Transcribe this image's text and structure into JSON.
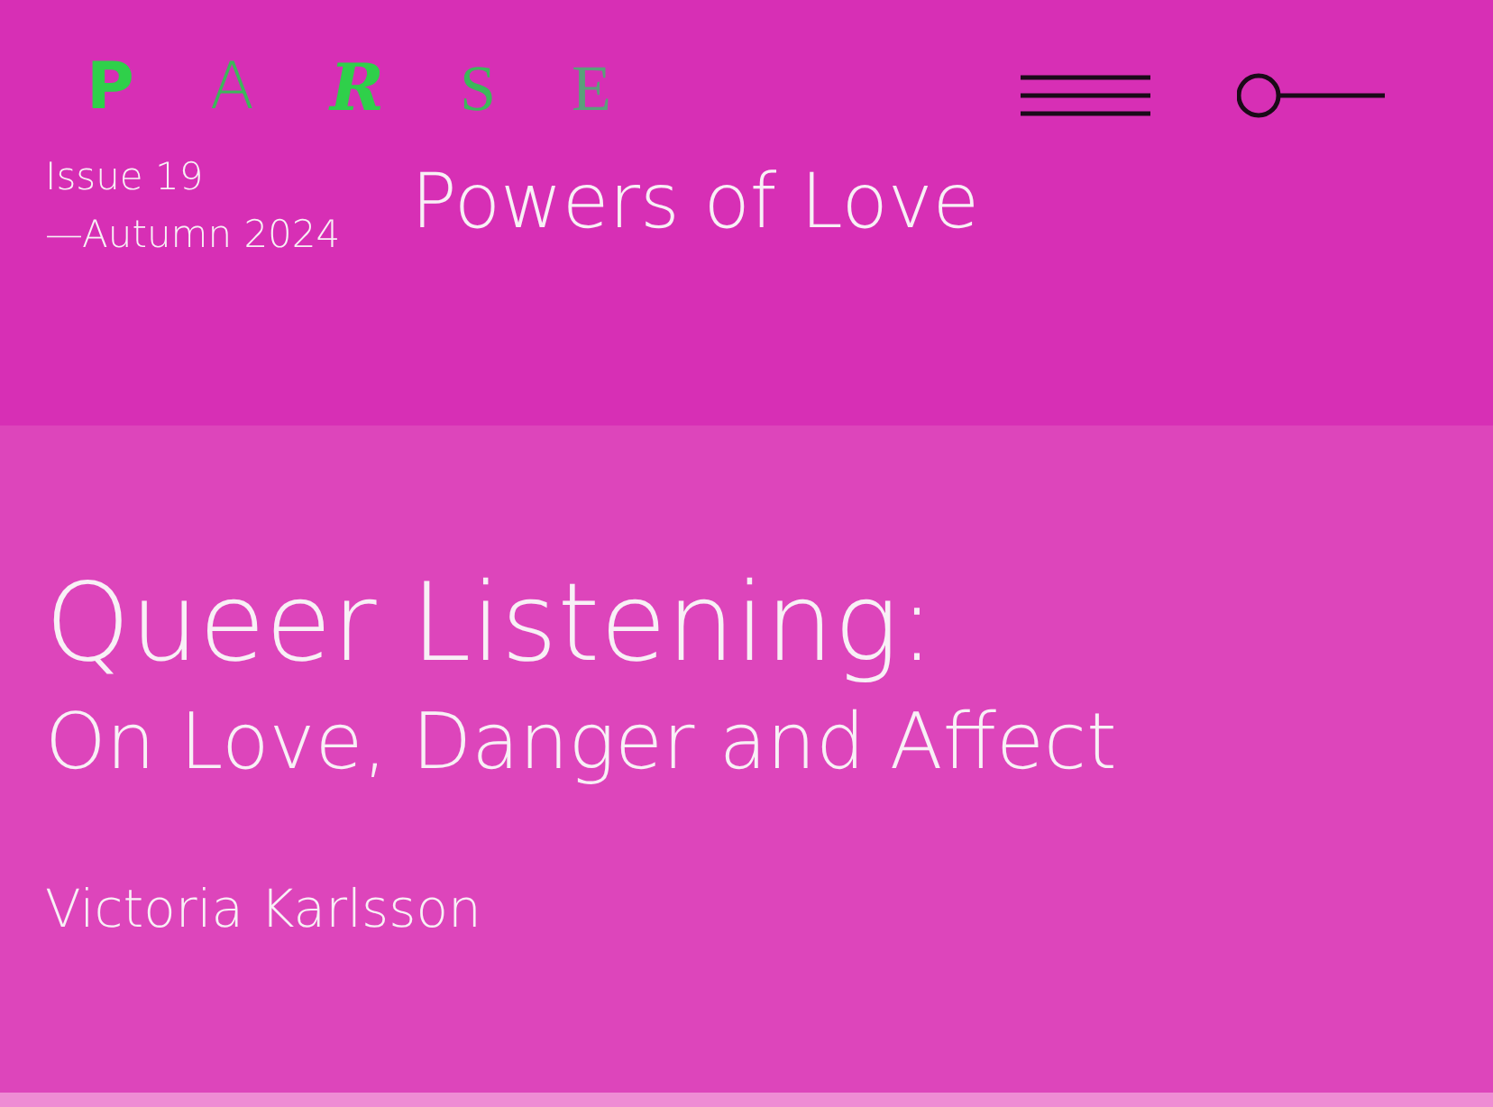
{
  "logo": {
    "letters": [
      {
        "text": "P",
        "kind": "bold"
      },
      {
        "text": "A",
        "kind": "thin"
      },
      {
        "text": "R",
        "kind": "blackletter"
      },
      {
        "text": "S",
        "kind": "serif"
      },
      {
        "text": "E",
        "kind": "hairline"
      }
    ]
  },
  "issue": {
    "number": "Issue 19",
    "season": "—Autumn 2024",
    "title": "Powers of Love"
  },
  "article": {
    "title": "Queer Listening:",
    "subtitle": "On Love, Danger and Affect",
    "author": "Victoria Karlsson"
  }
}
